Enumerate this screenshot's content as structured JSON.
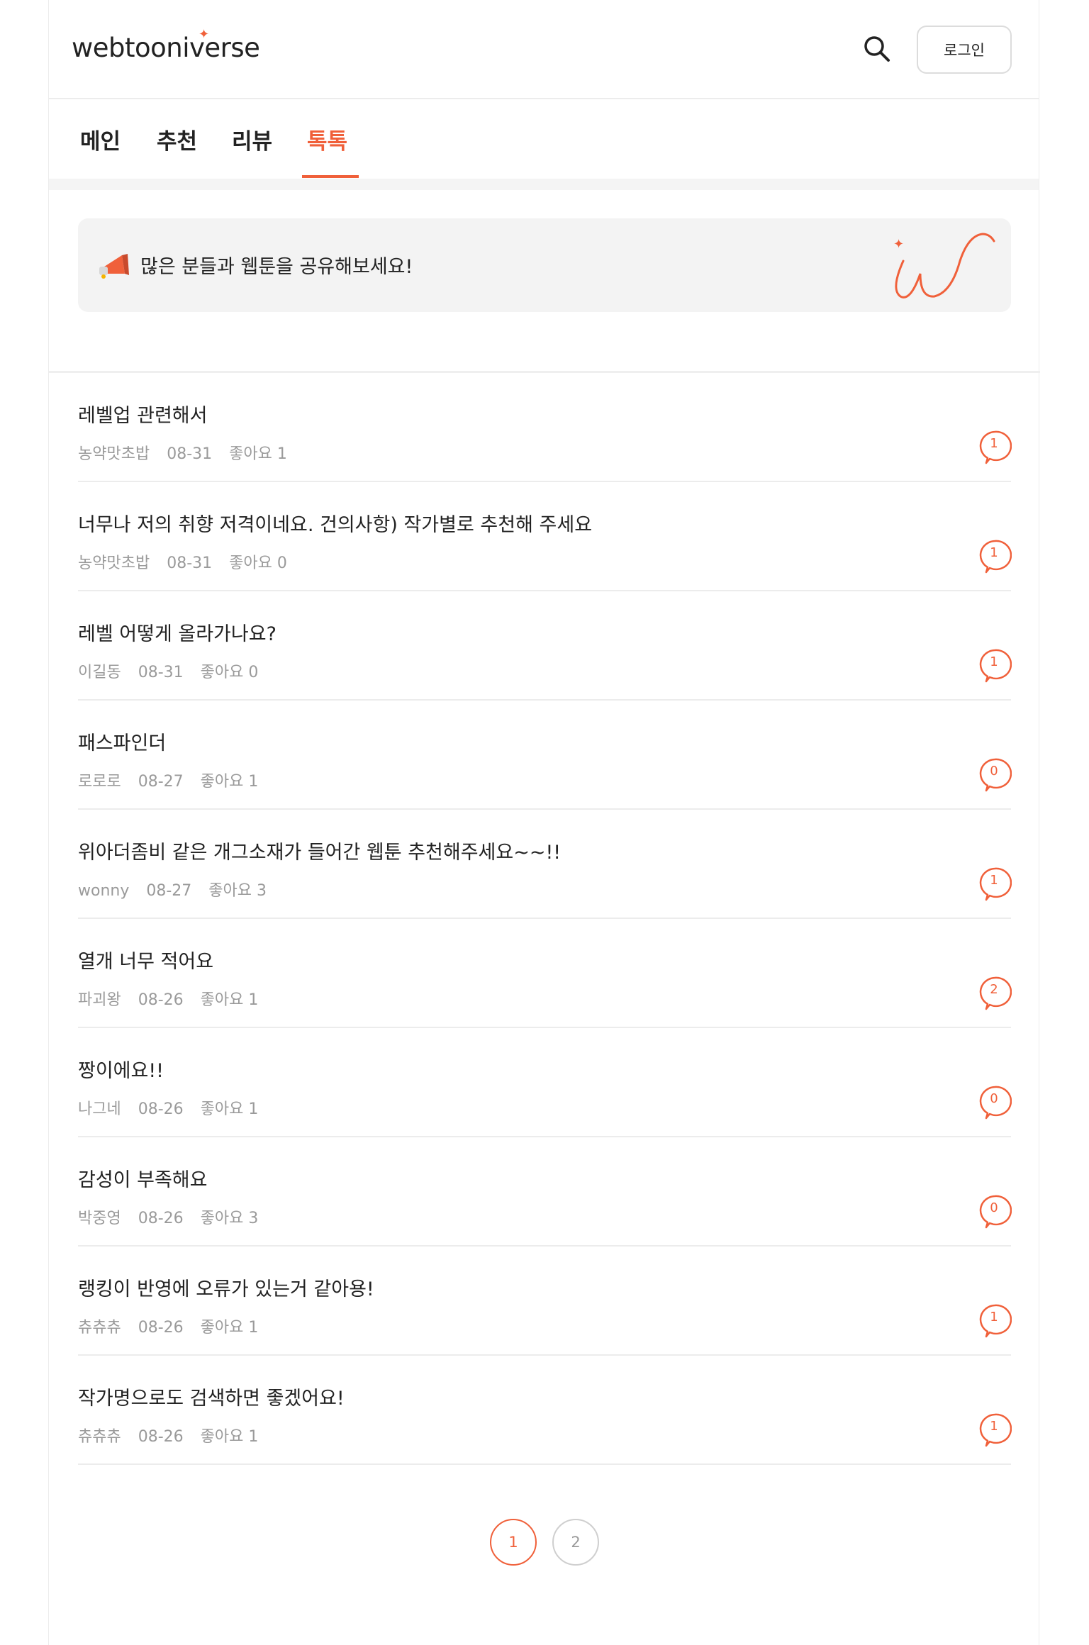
{
  "header": {
    "logo": "webtooniverse",
    "login_label": "로그인"
  },
  "tabs": [
    {
      "label": "메인"
    },
    {
      "label": "추천"
    },
    {
      "label": "리뷰"
    },
    {
      "label": "톡톡"
    }
  ],
  "active_tab": "톡톡",
  "banner": {
    "text": "많은 분들과 웹툰을 공유해보세요!"
  },
  "posts": [
    {
      "title": "레벨업 관련해서",
      "author": "농약맛초밥",
      "date": "08-31",
      "likes": "좋아요 1",
      "comments": "1"
    },
    {
      "title": "너무나 저의 취향 저격이네요. 건의사항) 작가별로 추천해 주세요",
      "author": "농약맛초밥",
      "date": "08-31",
      "likes": "좋아요 0",
      "comments": "1"
    },
    {
      "title": "레벨 어떻게 올라가나요?",
      "author": "이길동",
      "date": "08-31",
      "likes": "좋아요 0",
      "comments": "1"
    },
    {
      "title": "패스파인더",
      "author": "로로로",
      "date": "08-27",
      "likes": "좋아요 1",
      "comments": "0"
    },
    {
      "title": "위아더좀비 같은 개그소재가 들어간 웹툰 추천해주세요~~!!",
      "author": "wonny",
      "date": "08-27",
      "likes": "좋아요 3",
      "comments": "1"
    },
    {
      "title": "열개 너무 적어요",
      "author": "파괴왕",
      "date": "08-26",
      "likes": "좋아요 1",
      "comments": "2"
    },
    {
      "title": "짱이에요!!",
      "author": "나그네",
      "date": "08-26",
      "likes": "좋아요 1",
      "comments": "0"
    },
    {
      "title": "감성이 부족해요",
      "author": "박중영",
      "date": "08-26",
      "likes": "좋아요 3",
      "comments": "0"
    },
    {
      "title": "랭킹이 반영에 오류가 있는거 같아용!",
      "author": "츄츄츄",
      "date": "08-26",
      "likes": "좋아요 1",
      "comments": "1"
    },
    {
      "title": "작가명으로도 검색하면 좋겠어요!",
      "author": "츄츄츄",
      "date": "08-26",
      "likes": "좋아요 1",
      "comments": "1"
    }
  ],
  "pagination": {
    "pages": [
      "1",
      "2"
    ],
    "current": "1"
  },
  "colors": {
    "accent": "#f0603a",
    "muted_text": "#9a9a9a",
    "banner_bg": "#f3f3f3"
  },
  "icons": [
    "search-icon",
    "megaphone-icon",
    "comment-bubble-icon",
    "brand-w-icon"
  ]
}
